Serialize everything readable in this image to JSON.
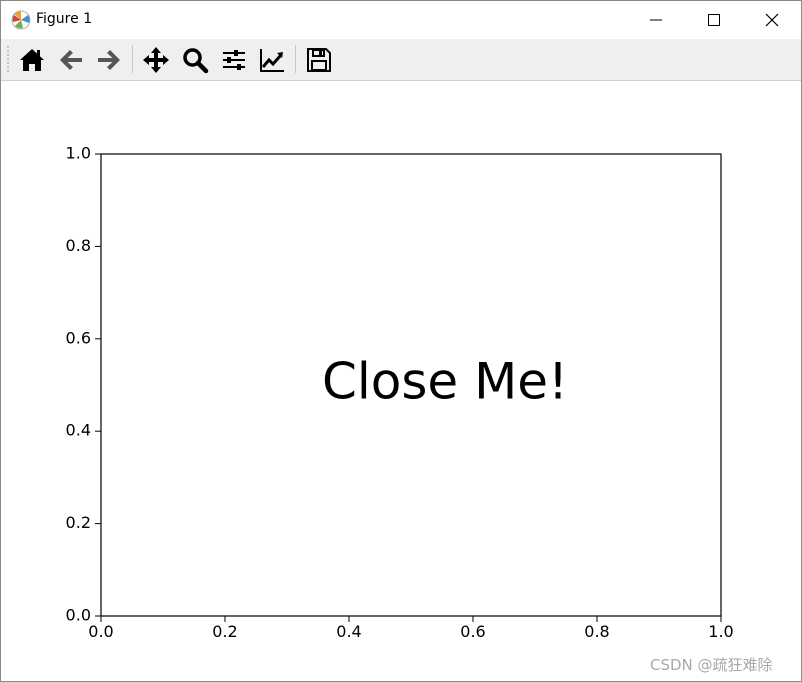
{
  "window": {
    "title": "Figure 1",
    "app_icon": "matplotlib-icon",
    "controls": {
      "minimize": "minimize-icon",
      "maximize": "maximize-icon",
      "close": "close-icon"
    }
  },
  "toolbar": {
    "tools": [
      {
        "name": "home",
        "icon": "home-icon"
      },
      {
        "name": "back",
        "icon": "arrow-left-icon"
      },
      {
        "name": "forward",
        "icon": "arrow-right-icon"
      },
      {
        "name": "pan",
        "icon": "move-icon"
      },
      {
        "name": "zoom",
        "icon": "magnifier-icon"
      },
      {
        "name": "subplots",
        "icon": "sliders-icon"
      },
      {
        "name": "customize",
        "icon": "line-chart-icon"
      },
      {
        "name": "save",
        "icon": "floppy-icon"
      }
    ]
  },
  "figure": {
    "text": "Close Me!"
  },
  "chart_data": {
    "type": "scatter",
    "series": [],
    "xlim": [
      0.0,
      1.0
    ],
    "ylim": [
      0.0,
      1.0
    ],
    "xticks": [
      "0.0",
      "0.2",
      "0.4",
      "0.6",
      "0.8",
      "1.0"
    ],
    "yticks": [
      "0.0",
      "0.2",
      "0.4",
      "0.6",
      "0.8",
      "1.0"
    ],
    "annotations": [
      {
        "text": "Close Me!",
        "x": 0.5,
        "y": 0.5
      }
    ],
    "grid": false,
    "title": "",
    "xlabel": "",
    "ylabel": ""
  },
  "watermark": "CSDN @疏狂难除"
}
